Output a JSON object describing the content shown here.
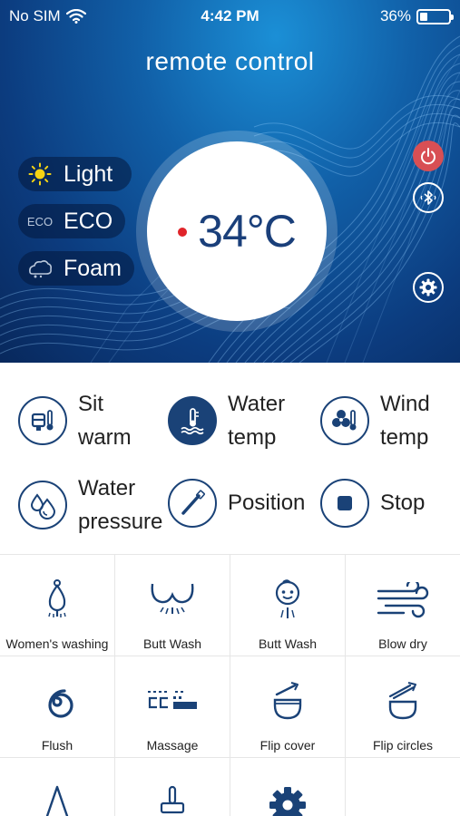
{
  "status_bar": {
    "carrier": "No SIM",
    "time": "4:42 PM",
    "battery": "36%",
    "battery_level": 0.36
  },
  "header": {
    "title": "remote control"
  },
  "modes": [
    {
      "label": "Light",
      "icon": "sun-icon"
    },
    {
      "label": "ECO",
      "icon": "eco-icon",
      "icon_text": "ECO"
    },
    {
      "label": "Foam",
      "icon": "foam-icon"
    }
  ],
  "temperature": {
    "value": "34°C",
    "indicator_color": "#e0242a"
  },
  "side_controls": [
    {
      "name": "power-icon",
      "color": "#d84f54"
    },
    {
      "name": "bluetooth-icon"
    },
    {
      "name": "gear-icon"
    }
  ],
  "quick_functions": [
    {
      "line1": "Sit",
      "line2": "warm",
      "icon": "seat-thermometer-icon"
    },
    {
      "line1": "Water",
      "line2": "temp",
      "icon": "water-thermometer-icon"
    },
    {
      "line1": "Wind",
      "line2": "temp",
      "icon": "fan-thermometer-icon"
    },
    {
      "line1": "Water",
      "line2": "pressure",
      "icon": "water-drops-icon"
    },
    {
      "label": "Position",
      "icon": "wand-icon"
    },
    {
      "label": "Stop",
      "icon": "stop-icon"
    }
  ],
  "grid_functions": [
    {
      "label": "Women's washing",
      "icon": "women-washing-icon"
    },
    {
      "label": "Butt Wash",
      "icon": "butt-wash-icon"
    },
    {
      "label": "Butt Wash",
      "icon": "child-wash-icon"
    },
    {
      "label": "Blow dry",
      "icon": "wind-icon"
    },
    {
      "label": "Flush",
      "icon": "flush-swirl-icon"
    },
    {
      "label": "Massage",
      "icon": "massage-icon"
    },
    {
      "label": "Flip cover",
      "icon": "flip-cover-icon"
    },
    {
      "label": "Flip circles",
      "icon": "flip-circles-icon"
    },
    {
      "label": "",
      "icon": "nozzle-icon"
    },
    {
      "label": "",
      "icon": "brush-icon"
    },
    {
      "label": "",
      "icon": "gear-icon"
    },
    {
      "label": "",
      "icon": "blank"
    }
  ],
  "colors": {
    "accent": "#1a4277",
    "hero_top": "#1b8fd6",
    "hero_bottom": "#08285c",
    "power": "#d84f54"
  }
}
